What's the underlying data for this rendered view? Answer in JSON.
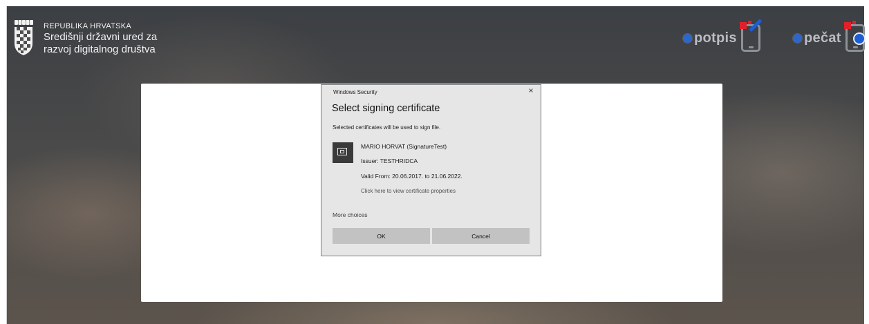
{
  "header": {
    "org_line1": "REPUBLIKA HRVATSKA",
    "org_line2": "Središnji državni ured za",
    "org_line3": "razvoj digitalnog društva"
  },
  "brands": [
    {
      "word": "potpis",
      "icon": "phone-pen-icon"
    },
    {
      "word": "pečat",
      "icon": "phone-seal-icon"
    }
  ],
  "colors": {
    "accent_blue": "#1e5dd2",
    "brand_red": "#e0212b",
    "dialog_bg": "#e6e6e6",
    "button_bg": "#c2c2c2"
  },
  "dialog": {
    "caption": "Windows Security",
    "close_glyph": "×",
    "title": "Select signing certificate",
    "description": "Selected certificates will be used to sign file.",
    "certificate": {
      "name": "MARIO HORVAT (SignatureTest)",
      "issuer": "Issuer: TESTHRIDCA",
      "valid": "Valid From: 20.06.2017. to 21.06.2022.",
      "properties_link": "Click here to view certificate properties"
    },
    "more_choices": "More choices",
    "ok_label": "OK",
    "cancel_label": "Cancel"
  }
}
